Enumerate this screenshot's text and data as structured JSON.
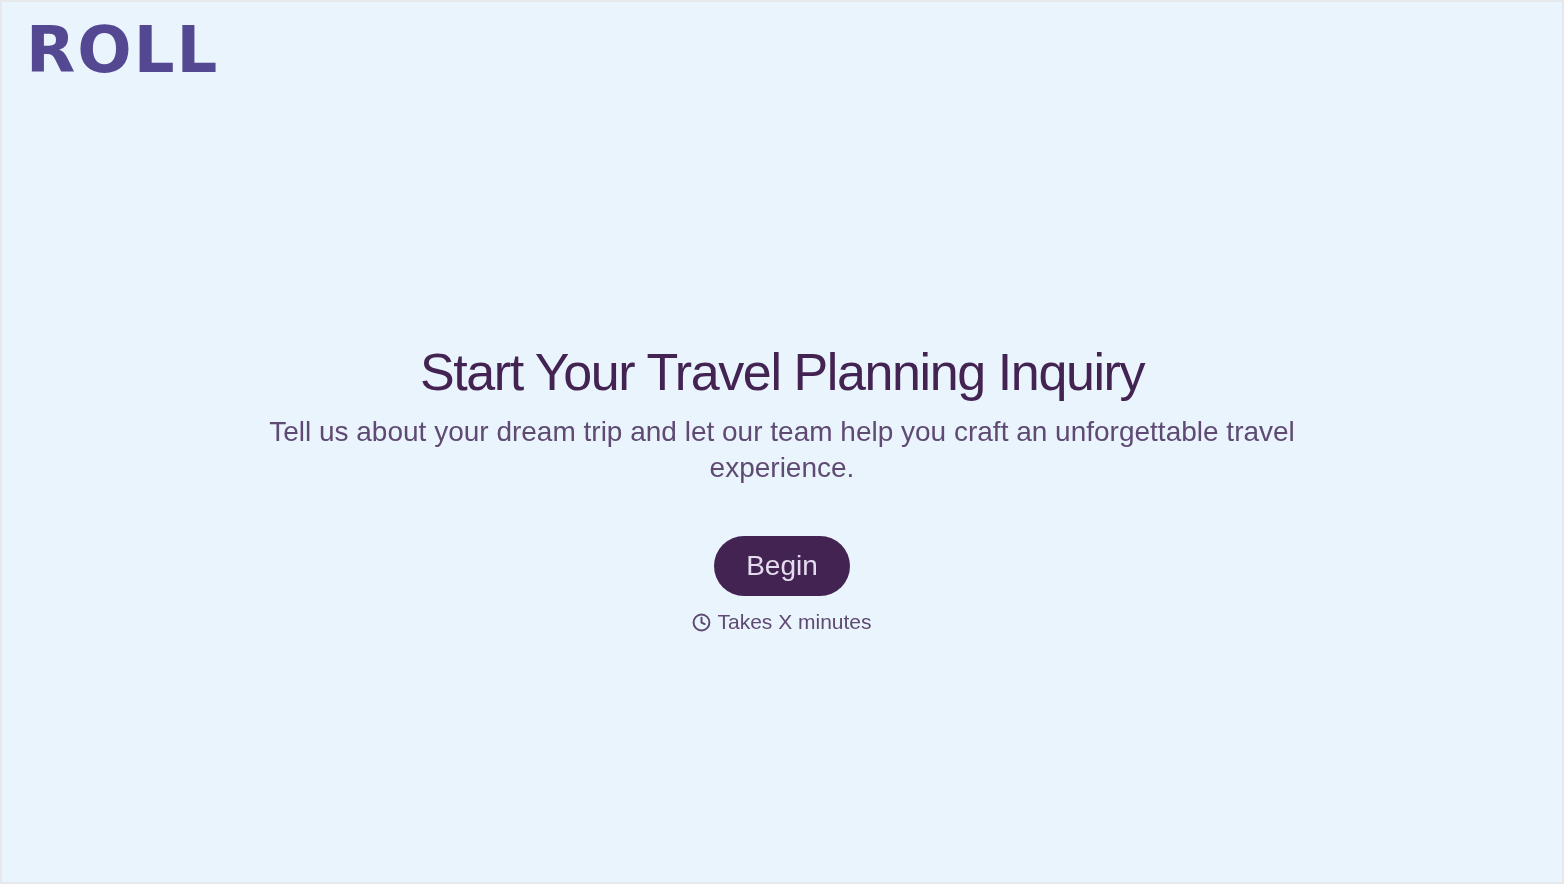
{
  "header": {
    "logo": "ROLL"
  },
  "hero": {
    "title": "Start Your Travel Planning Inquiry",
    "subtitle": "Tell us about your dream trip and let our team help you craft an unforgettable travel experience.",
    "button": {
      "label": "Begin"
    },
    "duration": "Takes X minutes"
  }
}
